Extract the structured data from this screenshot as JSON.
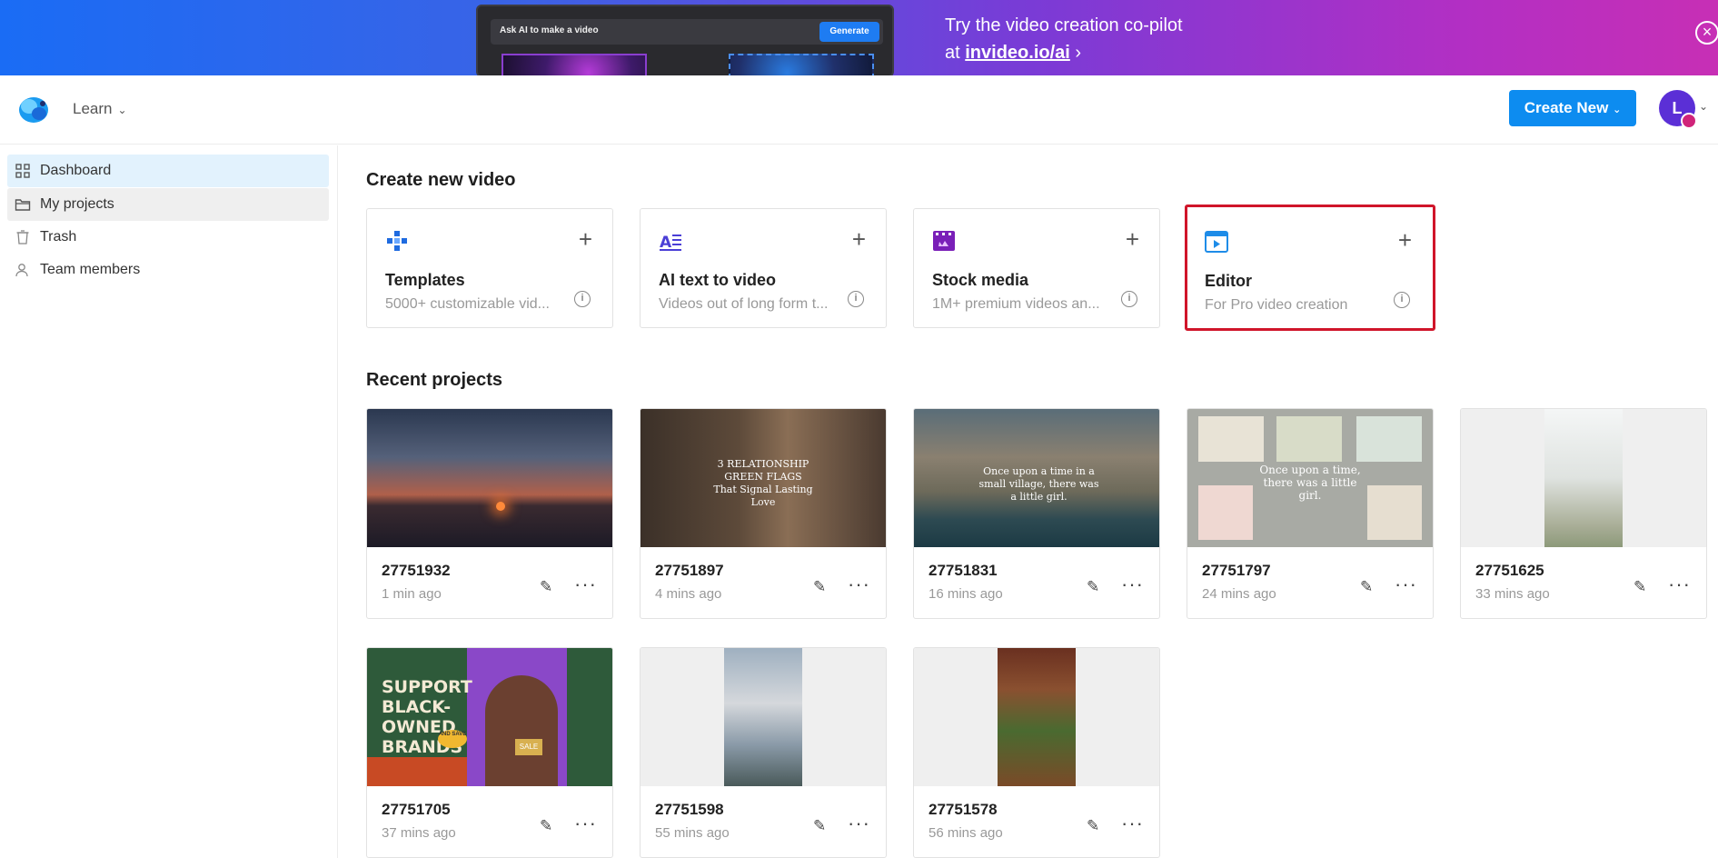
{
  "banner": {
    "promo_input": "Ask AI to make a video",
    "promo_generate": "Generate",
    "line1": "Try the video creation co-pilot",
    "line2_prefix": "at ",
    "line2_link": "invideo.io/ai",
    "line2_suffix": " ›",
    "close_glyph": "×"
  },
  "header": {
    "learn_label": "Learn",
    "create_new_label": "Create New",
    "avatar_initial": "L"
  },
  "sidebar": {
    "items": [
      {
        "label": "Dashboard",
        "icon": "grid-icon"
      },
      {
        "label": "My projects",
        "icon": "folder-icon"
      },
      {
        "label": "Trash",
        "icon": "trash-icon"
      },
      {
        "label": "Team members",
        "icon": "team-icon"
      }
    ]
  },
  "create": {
    "title": "Create new video",
    "cards": [
      {
        "title": "Templates",
        "subtitle": "5000+ customizable vid...",
        "icon": "templates-icon"
      },
      {
        "title": "AI text to video",
        "subtitle": "Videos out of long form t...",
        "icon": "ai-text-icon"
      },
      {
        "title": "Stock media",
        "subtitle": "1M+ premium videos an...",
        "icon": "stock-media-icon"
      },
      {
        "title": "Editor",
        "subtitle": "For Pro video creation",
        "icon": "editor-icon"
      }
    ]
  },
  "recent": {
    "title": "Recent projects",
    "projects": [
      {
        "id": "27751932",
        "time": "1 min ago"
      },
      {
        "id": "27751897",
        "time": "4 mins ago",
        "overlay": "3 RELATIONSHIP GREEN FLAGS That Signal Lasting Love"
      },
      {
        "id": "27751831",
        "time": "16 mins ago",
        "overlay": "Once upon a time in a small village, there was a little girl."
      },
      {
        "id": "27751797",
        "time": "24 mins ago",
        "overlay": "Once upon a time, there was a little girl."
      },
      {
        "id": "27751625",
        "time": "33 mins ago"
      },
      {
        "id": "27751705",
        "time": "37 mins ago",
        "overlay": "SUPPORT BLACK-OWNED BRANDS",
        "badge": "AND SAVE",
        "sign": "SALE"
      },
      {
        "id": "27751598",
        "time": "55 mins ago"
      },
      {
        "id": "27751578",
        "time": "56 mins ago"
      }
    ]
  },
  "colors": {
    "accent": "#0d8cf0",
    "highlight": "#d0152a",
    "active_bg": "#e2f2fd"
  }
}
